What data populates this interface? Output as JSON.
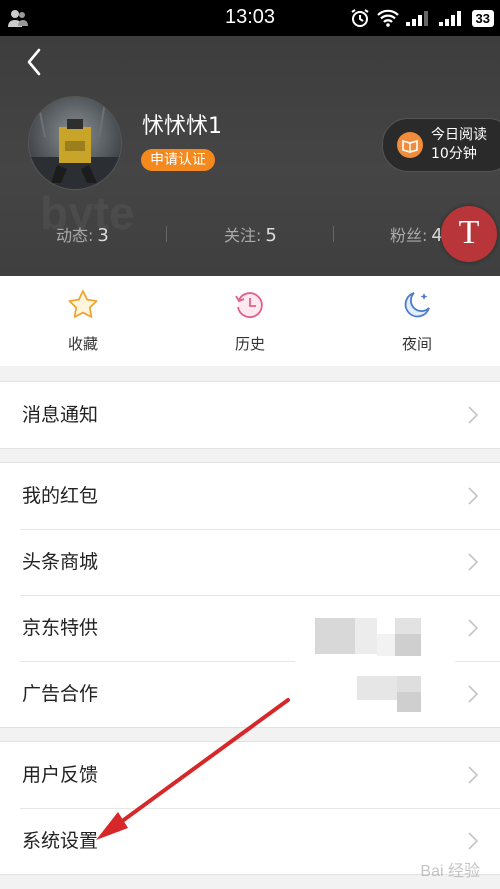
{
  "status_bar": {
    "time": "13:03",
    "battery": "33"
  },
  "profile": {
    "username": "怵怵怵1",
    "verify_label": "申请认证",
    "reading_badge": {
      "line1": "今日阅读",
      "line2": "10分钟"
    },
    "stats": [
      {
        "label": "动态:",
        "value": "3"
      },
      {
        "label": "关注:",
        "value": "5"
      },
      {
        "label": "粉丝:",
        "value": "4"
      }
    ],
    "float_button_letter": "T"
  },
  "quick_actions": [
    {
      "label": "收藏",
      "icon": "star-icon"
    },
    {
      "label": "历史",
      "icon": "history-clock-icon"
    },
    {
      "label": "夜间",
      "icon": "night-moon-icon"
    }
  ],
  "menu_groups": [
    [
      "消息通知"
    ],
    [
      "我的红包",
      "头条商城",
      "京东特供",
      "广告合作"
    ],
    [
      "用户反馈",
      "系统设置"
    ]
  ],
  "watermark": "Bai 经验",
  "colors": {
    "accent_orange": "#f4891e",
    "header_bg": "#424242",
    "float_button": "#b8363a",
    "annotation_arrow": "#d62828"
  }
}
